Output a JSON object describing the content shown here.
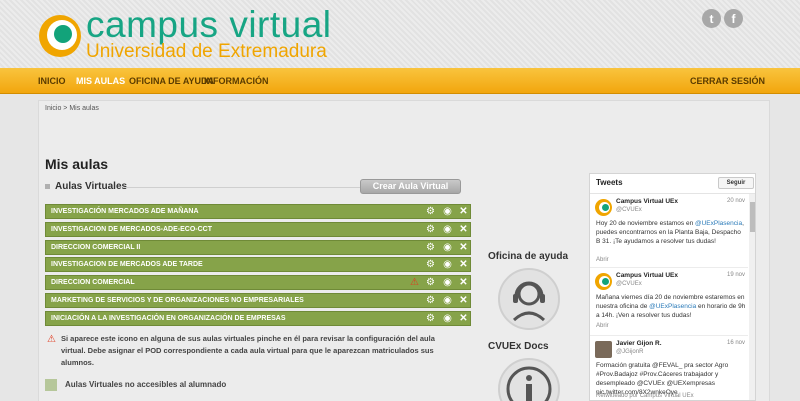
{
  "header": {
    "title": "campus virtual",
    "subtitle": "Universidad de Extremadura",
    "twitter_icon": "twitter-icon",
    "facebook_icon": "facebook-icon",
    "twitter_glyph": "t",
    "facebook_glyph": "f"
  },
  "nav": {
    "items": [
      {
        "label": "INICIO"
      },
      {
        "label": "MIS AULAS"
      },
      {
        "label": "OFICINA DE AYUDA"
      },
      {
        "label": "INFORMACIÓN"
      }
    ],
    "logout": "CERRAR SESIÓN",
    "active_index": 1
  },
  "breadcrumb": "Inicio > Mis aulas",
  "page_title": "Mis aulas",
  "section": {
    "label": "Aulas Virtuales",
    "create_button": "Crear Aula Virtual"
  },
  "aulas": [
    {
      "name": "INVESTIGACIÓN MERCADOS ADE MAÑANA",
      "warning": false
    },
    {
      "name": "INVESTIGACION DE MERCADOS-ADE-ECO-CCT",
      "warning": false
    },
    {
      "name": "DIRECCION COMERCIAL II",
      "warning": false
    },
    {
      "name": "INVESTIGACION DE MERCADOS ADE TARDE",
      "warning": false
    },
    {
      "name": "DIRECCION COMERCIAL",
      "warning": true
    },
    {
      "name": "MARKETING DE SERVICIOS Y DE ORGANIZACIONES NO EMPRESARIALES",
      "warning": false
    },
    {
      "name": "INICIACIÓN A LA INVESTIGACIÓN EN ORGANIZACIÓN DE EMPRESAS",
      "warning": false
    }
  ],
  "note": "Si aparece este icono en alguna de sus aulas virtuales pinche en él para revisar la configuración del aula virtual. Debe asignar el POD correspondiente a cada aula virtual para que le aparezcan matriculados sus alumnos.",
  "legend": "Aulas Virtuales no accesibles al alumnado",
  "side": {
    "help_title": "Oficina de ayuda",
    "docs_title": "CVUEx Docs",
    "help_icon": "headset-icon",
    "docs_icon": "info-icon"
  },
  "tweets": {
    "title": "Tweets",
    "follow": "Seguir",
    "open_label": "Abrir",
    "items": [
      {
        "author": "Campus Virtual UEx",
        "handle": "@CVUEx",
        "date": "20 nov",
        "text_parts": [
          "Hoy 20 de noviembre estamos en ",
          "@UExPlasencia",
          ", puedes encontrarnos en la Planta Baja, Despacho B 31. ¡Te ayudamos a resolver tus dudas!"
        ]
      },
      {
        "author": "Campus Virtual UEx",
        "handle": "@CVUEx",
        "date": "19 nov",
        "text_parts": [
          "Mañana viernes día 20 de noviembre estaremos en nuestra oficina de ",
          "@UExPlasencia",
          " en horario de 9h a 14h. ¡Ven a resolver tus dudas!"
        ]
      },
      {
        "author": "Javier Gijon R.",
        "handle": "@JGijonR",
        "date": "16 nov",
        "text": "Formación gratuita @FEVAL_ pra sector Agro #Prov.Badajoz #Prov.Cáceres trabajador y desempleado @CVUEx @UEXempresas pic.twitter.com/8X2wnkeOye"
      }
    ],
    "retweet": "Retwitteado por Campus Virtual UEx"
  }
}
